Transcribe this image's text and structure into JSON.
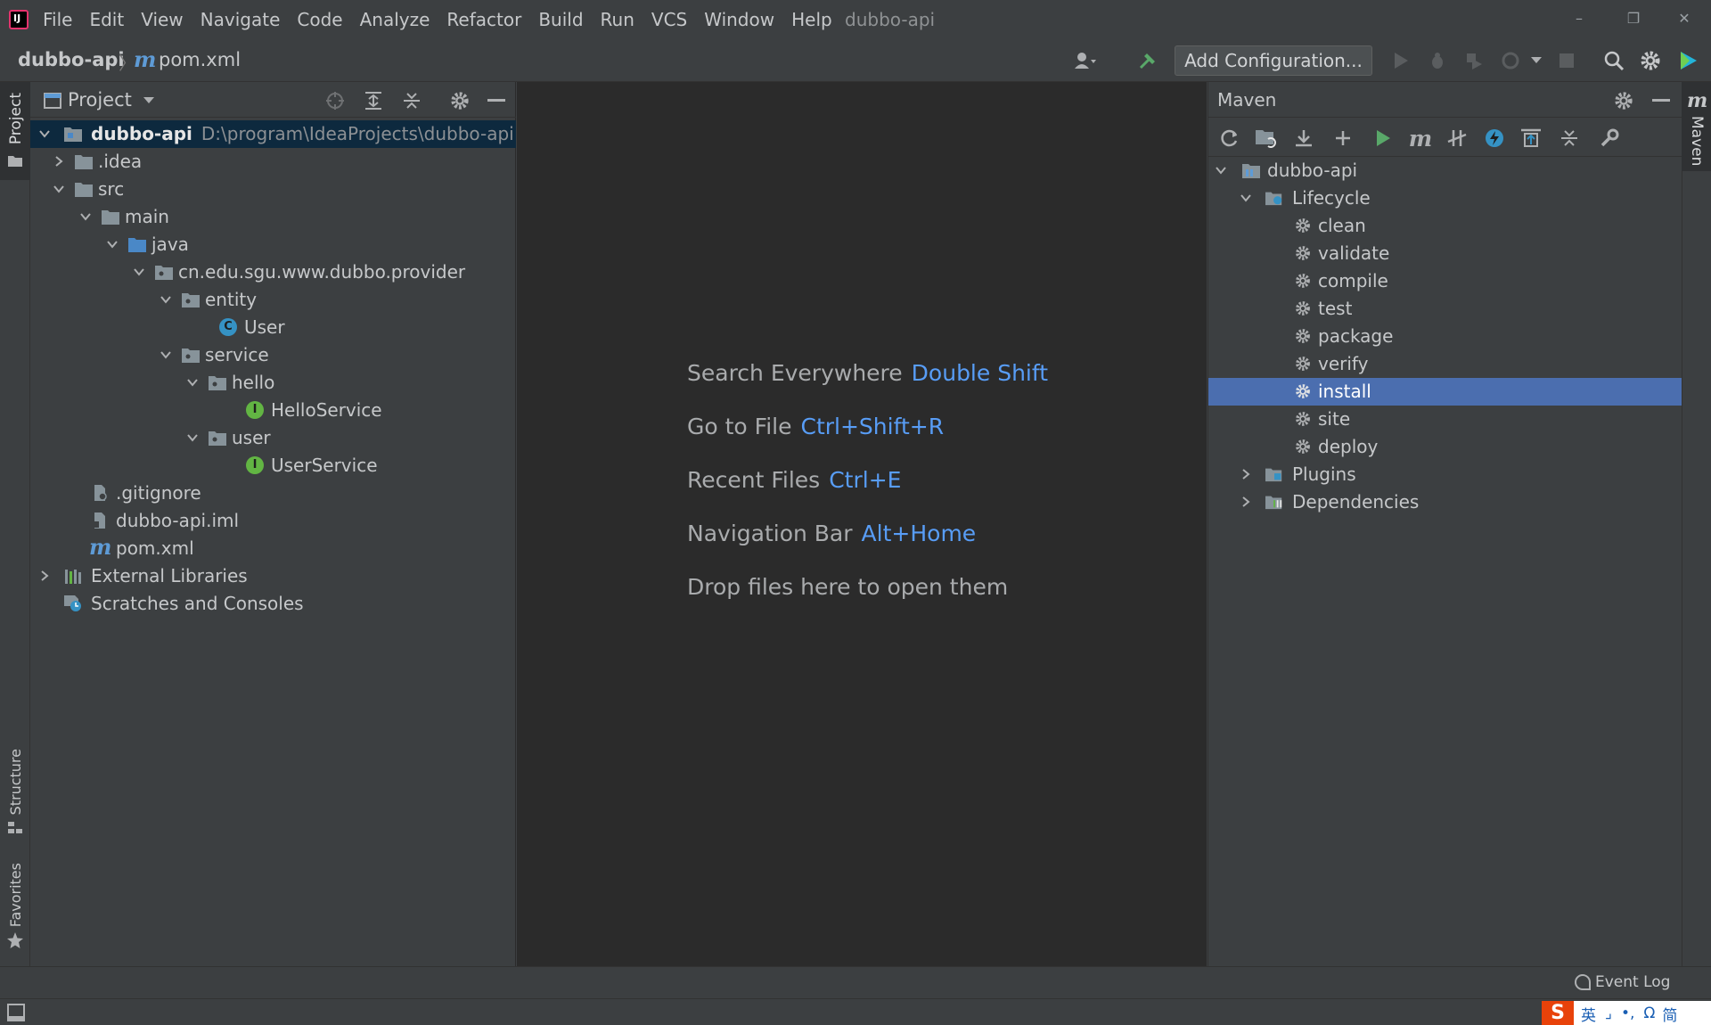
{
  "app": {
    "window_title": "dubbo-api",
    "logo_text": "IJ"
  },
  "menu": [
    "File",
    "Edit",
    "View",
    "Navigate",
    "Code",
    "Analyze",
    "Refactor",
    "Build",
    "Run",
    "VCS",
    "Window",
    "Help"
  ],
  "window_controls": {
    "minimize": "–",
    "restore": "❐",
    "close": "✕"
  },
  "navbar": {
    "project": "dubbo-api",
    "separator": "〉",
    "file_prefix": "m",
    "file": "pom.xml",
    "run_config": "Add Configuration..."
  },
  "left_stripe": {
    "project": "Project",
    "structure": "Structure",
    "favorites": "Favorites"
  },
  "project_panel": {
    "title": "Project",
    "tree": [
      {
        "label": "dubbo-api",
        "path": "D:\\program\\IdeaProjects\\dubbo-api"
      },
      {
        "label": ".idea"
      },
      {
        "label": "src"
      },
      {
        "label": "main"
      },
      {
        "label": "java"
      },
      {
        "label": "cn.edu.sgu.www.dubbo.provider"
      },
      {
        "label": "entity"
      },
      {
        "label": "User",
        "icon_letter": "C"
      },
      {
        "label": "service"
      },
      {
        "label": "hello"
      },
      {
        "label": "HelloService",
        "icon_letter": "I"
      },
      {
        "label": "user"
      },
      {
        "label": "UserService",
        "icon_letter": "I"
      },
      {
        "label": ".gitignore"
      },
      {
        "label": "dubbo-api.iml"
      },
      {
        "label": "pom.xml",
        "icon_letter": "m"
      },
      {
        "label": "External Libraries"
      },
      {
        "label": "Scratches and Consoles"
      }
    ]
  },
  "editor": {
    "hints": [
      {
        "text": "Search Everywhere",
        "key": "Double Shift"
      },
      {
        "text": "Go to File",
        "key": "Ctrl+Shift+R"
      },
      {
        "text": "Recent Files",
        "key": "Ctrl+E"
      },
      {
        "text": "Navigation Bar",
        "key": "Alt+Home"
      },
      {
        "text": "Drop files here to open them",
        "key": ""
      }
    ]
  },
  "maven_panel": {
    "title": "Maven",
    "toolbar_m": "m",
    "tree": [
      {
        "label": "dubbo-api"
      },
      {
        "label": "Lifecycle"
      },
      {
        "label": "clean"
      },
      {
        "label": "validate"
      },
      {
        "label": "compile"
      },
      {
        "label": "test"
      },
      {
        "label": "package"
      },
      {
        "label": "verify"
      },
      {
        "label": "install"
      },
      {
        "label": "site"
      },
      {
        "label": "deploy"
      },
      {
        "label": "Plugins"
      },
      {
        "label": "Dependencies"
      }
    ],
    "selected": "install"
  },
  "right_stripe": {
    "maven": "Maven",
    "maven_icon": "m"
  },
  "status": {
    "event_log": "Event Log",
    "ime": [
      "英",
      "⌟",
      "•,",
      "Ω",
      "简"
    ]
  },
  "colors": {
    "selection": "#4b6eaf",
    "link_key": "#589df6",
    "editor_bg": "#2b2b2b",
    "panel_bg": "#3c3f41"
  }
}
